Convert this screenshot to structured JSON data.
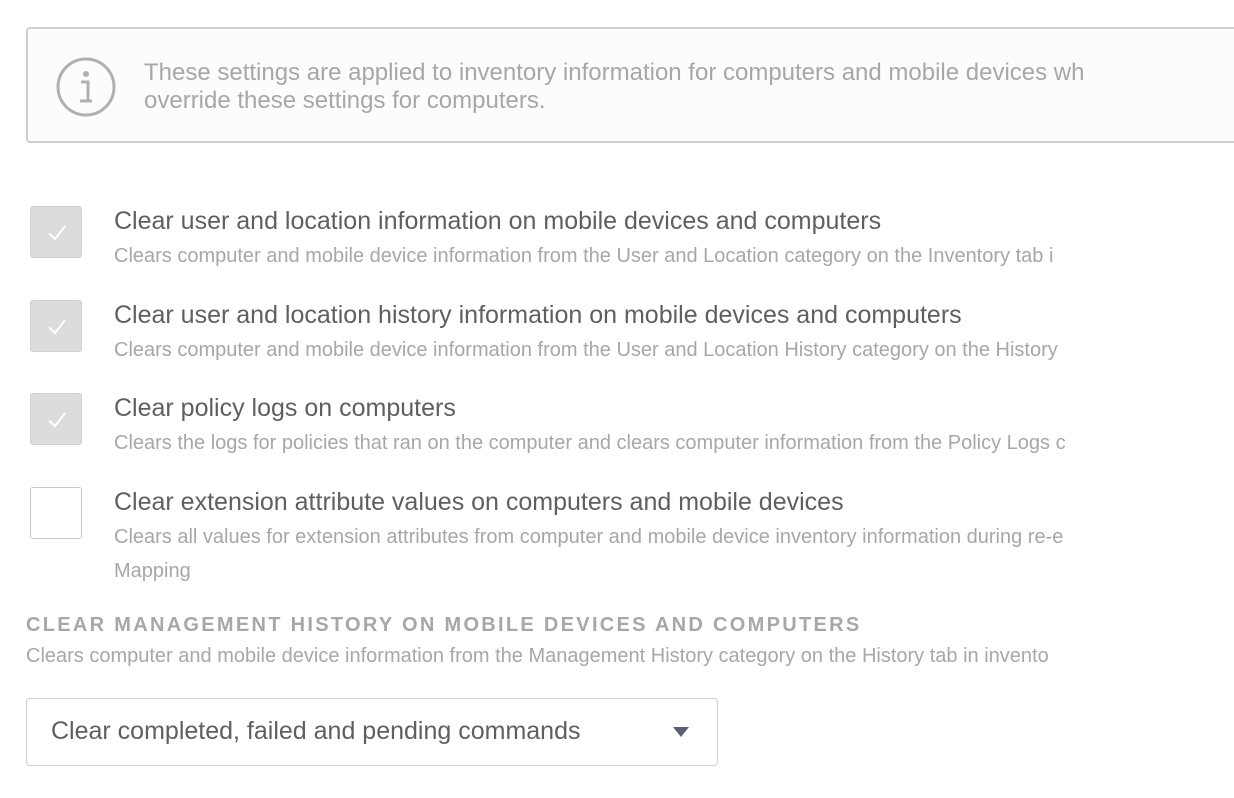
{
  "info": {
    "icon": "info-circle-icon",
    "line1": "These settings are applied to inventory information for computers and mobile devices wh",
    "line2": "override these settings for computers."
  },
  "options": [
    {
      "label": "Clear user and location information on mobile devices and computers",
      "description": "Clears computer and mobile device information from the User and Location category on the Inventory tab i",
      "checked": true
    },
    {
      "label": "Clear user and location history information on mobile devices and computers",
      "description": "Clears computer and mobile device information from the User and Location History category on the History",
      "checked": true
    },
    {
      "label": "Clear policy logs on computers",
      "description": "Clears the logs for policies that ran on the computer and clears computer information from the Policy Logs c",
      "checked": true
    },
    {
      "label": "Clear extension attribute values on computers and mobile devices",
      "description": "Clears all values for extension attributes from computer and mobile device inventory information during re-e",
      "description_line2": "Mapping",
      "checked": false
    }
  ],
  "management_history": {
    "heading": "CLEAR MANAGEMENT HISTORY ON MOBILE DEVICES AND COMPUTERS",
    "description": "Clears computer and mobile device information from the Management History category on the History tab in invento",
    "select_value": "Clear completed, failed and pending commands"
  },
  "colors": {
    "text": "#5f5f5f",
    "muted_text": "#a7a7a7",
    "checkbox_checked_bg": "#dcdcdc",
    "border": "#cfcfcf"
  }
}
